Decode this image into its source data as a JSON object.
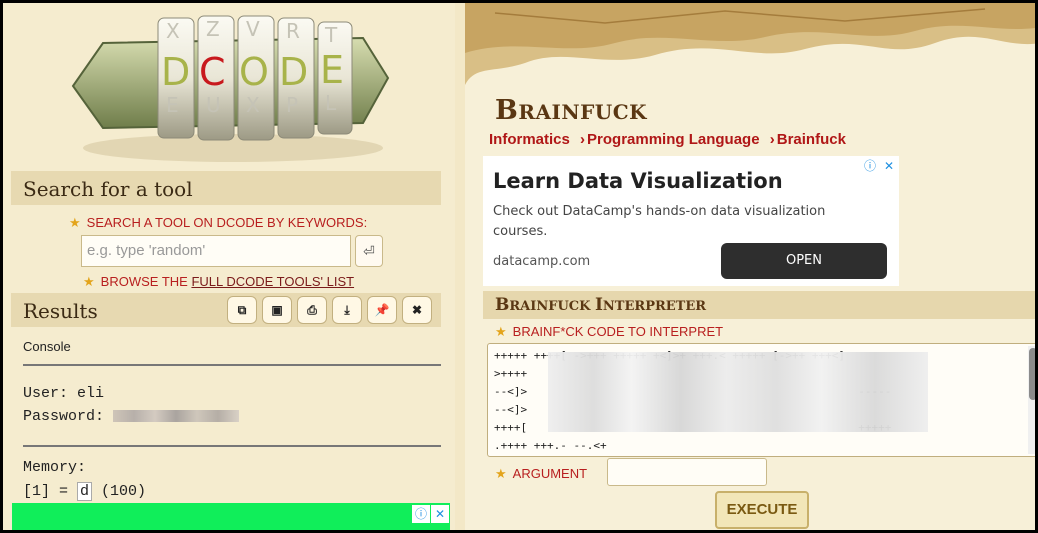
{
  "left": {
    "logo": {
      "letters": [
        "D",
        "C",
        "O",
        "D",
        "E"
      ],
      "accent": "#c8191d"
    },
    "search_section": {
      "title": "Search for a tool",
      "keywords_label": "SEARCH A TOOL ON DCODE BY KEYWORDS:",
      "search_placeholder": "e.g. type 'random'",
      "enter_icon": "⏎",
      "browse_prefix": "BROWSE THE ",
      "browse_link": "FULL DCODE TOOLS' LIST"
    },
    "results_section": {
      "title": "Results",
      "tool_buttons": [
        {
          "icon": "copy-icon",
          "glyph": "⧉"
        },
        {
          "icon": "save-icon",
          "glyph": "▣"
        },
        {
          "icon": "print-icon",
          "glyph": "⎙"
        },
        {
          "icon": "download-icon",
          "glyph": "⤓"
        },
        {
          "icon": "pin-icon",
          "glyph": "📌"
        },
        {
          "icon": "close-icon",
          "glyph": "✖"
        }
      ],
      "console_label": "Console",
      "user_line": "User: eli",
      "password_label": "Password:",
      "memory_label": "Memory:",
      "memory_prefix": "[1] = ",
      "memory_char": "d",
      "memory_suffix": " (100)"
    }
  },
  "right": {
    "title_big": "B",
    "title_rest": "RAINFUCK",
    "breadcrumbs": [
      "Informatics",
      "Programming Language",
      "Brainfuck"
    ],
    "breadcrumb_sep": "›",
    "ad": {
      "title": "Learn Data Visualization",
      "body": "Check out DataCamp's hands-on data visualization courses.",
      "domain": "datacamp.com",
      "button": "OPEN"
    },
    "interpreter": {
      "title_B": "B",
      "title_rest1": "RAINFUCK ",
      "title_I": "I",
      "title_rest2": "NTERPRETER",
      "code_label": "BRAINF*CK CODE TO INTERPRET",
      "code_lines": [
        "+++++ ++++[ ->+++ +++++ +<]>+ +++.< +++++ [->++ +++<]",
        ">++++",
        "--<]>                                                  -----",
        "--<]>",
        "++++[                                                  +++++",
        ".++++ +++.- --.<+"
      ],
      "argument_label": "ARGUMENT",
      "argument_value": "",
      "execute_label": "EXECUTE"
    }
  },
  "colors": {
    "red_text": "#b81f1f",
    "star": "#e3a41b",
    "heading_brown": "#5a3713",
    "green_ad": "#10ee5a"
  }
}
